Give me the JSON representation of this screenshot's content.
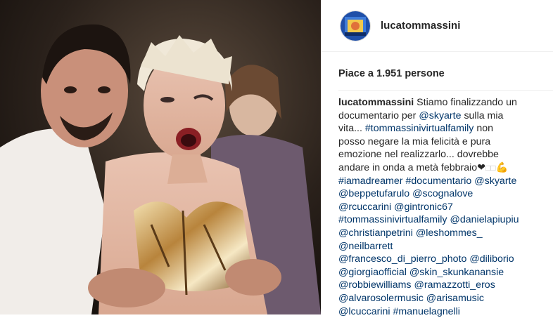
{
  "post": {
    "username": "lucatommassini",
    "likes_label": "Piace a 1.951 persone",
    "caption": {
      "line1": {
        "user": "lucatommassini",
        "text": " Stiamo finalizzando un"
      },
      "line2": {
        "text": "documentario per ",
        "link": "@skyarte",
        "text2": " sulla mia"
      },
      "line3": {
        "text": "vita... ",
        "link": "#tommassinivirtualfamily",
        "text2": " non"
      },
      "line4": {
        "text": "posso negare la mia felicità e pura"
      },
      "line5": {
        "text": "emozione nel realizzarlo... dovrebbe"
      },
      "line6": {
        "text": "andare in onda a metà febbraio",
        "emoji1": "❤",
        "emoji2": "□□",
        "emoji3": "💪"
      },
      "line7": {
        "a": "#iamadreamer",
        "b": "#documentario",
        "c": "@skyarte"
      },
      "line8": {
        "a": "@beppetufarulo",
        "b": "@scognalove"
      },
      "line9": {
        "a": "@rcuccarini",
        "b": "@gintronic67"
      },
      "line10": {
        "a": "#tommassinivirtualfamily",
        "b": "@danielapiupiu"
      },
      "line11": {
        "a": "@christianpetrini",
        "b": "@leshommes_"
      },
      "line12": {
        "a": "@neilbarrett"
      },
      "line13": {
        "a": "@francesco_di_pierro_photo",
        "b": "@diliborio"
      },
      "line14": {
        "a": "@giorgiaofficial",
        "b": "@skin_skunkanansie"
      },
      "line15": {
        "a": "@robbiewilliams",
        "b": "@ramazzotti_eros"
      },
      "line16": {
        "a": "@alvarosolermusic",
        "b": "@arisamusic"
      },
      "line17": {
        "a": "@lcuccarini",
        "b": "#manuelagnelli"
      }
    }
  },
  "colors": {
    "link": "#003569",
    "text": "#262626",
    "border": "#efefef"
  },
  "icons": {
    "avatar": "avatar-image",
    "photo": "post-photo"
  }
}
